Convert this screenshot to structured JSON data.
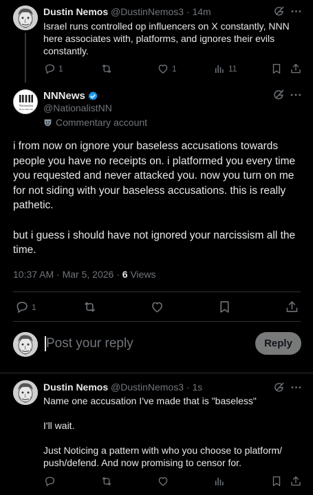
{
  "tweet1": {
    "name": "Dustin Nemos",
    "handle": "@DustinNemos3",
    "time": "· 14m",
    "text_lines": [
      "Israel runs controlled op influencers on X constantly, NNN",
      "here associates with, platforms, and ignores their evils",
      "constantly."
    ],
    "replies": "1",
    "likes": "1",
    "views": "11"
  },
  "main_tweet": {
    "name": "NNNews",
    "handle": "@NationalistNN",
    "commentary_label": "Commentary account",
    "avatar_text": [
      "Nationalist",
      "News Network"
    ],
    "paragraph1_lines": [
      "i from now on ignore your baseless accusations towards",
      "people you have no receipts on. i platformed you every time",
      "you requested and never attacked you. now you turn on me",
      "for not siding with your baseless accusations. this is really",
      "pathetic."
    ],
    "paragraph2_lines": [
      "but i guess i should have not ignored your narcissism all the",
      "time."
    ],
    "timestamp": "10:37 AM · Mar 5, 2026 ·",
    "views_count": "6",
    "views_label": "Views",
    "replies": "1"
  },
  "reply_composer": {
    "placeholder": "Post your reply",
    "button_label": "Reply"
  },
  "tweet3": {
    "name": "Dustin Nemos",
    "handle": "@DustinNemos3",
    "time": "· 1s",
    "line1": "Name one accusation I've made that is \"baseless\"",
    "line2": "I'll wait.",
    "line3_lines": [
      "Just Noticing a pattern with who you choose to platform/",
      "push/defend. And now promising to censor for."
    ]
  },
  "colors": {
    "background": "#000000",
    "text": "#e7e9ea",
    "muted": "#71767b",
    "divider": "#2f3336",
    "verified": "#1d9bf0",
    "reply_button_bg": "#787a7a"
  },
  "icons": [
    "grok-icon",
    "more-icon",
    "reply-icon",
    "retweet-icon",
    "like-icon",
    "views-icon",
    "bookmark-icon",
    "share-icon",
    "verified-badge-icon",
    "commentary-mask-icon"
  ]
}
